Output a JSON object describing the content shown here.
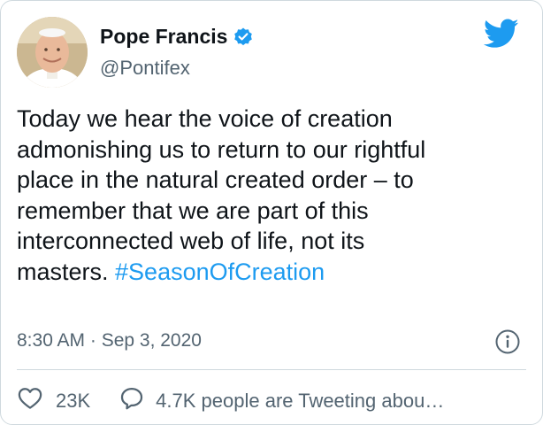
{
  "author": {
    "display_name": "Pope Francis",
    "handle": "@Pontifex",
    "verified": true
  },
  "tweet": {
    "text_lines": [
      "Today we hear the voice of creation",
      "admonishing us to return to our rightful",
      "place in the natural created order – to",
      "remember that we are part of this",
      "interconnected web of life, not its",
      "masters. "
    ],
    "hashtag": "#SeasonOfCreation",
    "timestamp": "8:30 AM · Sep 3, 2020"
  },
  "actions": {
    "likes": "23K",
    "conversation": "4.7K people are Tweeting abou…"
  },
  "icons": {
    "brand": "twitter-bird-icon",
    "verified": "verified-badge-icon",
    "info": "info-icon",
    "like": "heart-icon",
    "reply": "speech-bubble-icon"
  },
  "colors": {
    "accent": "#1d9bf0",
    "text": "#0f1419",
    "secondary": "#536471",
    "border": "#cfd9de"
  }
}
